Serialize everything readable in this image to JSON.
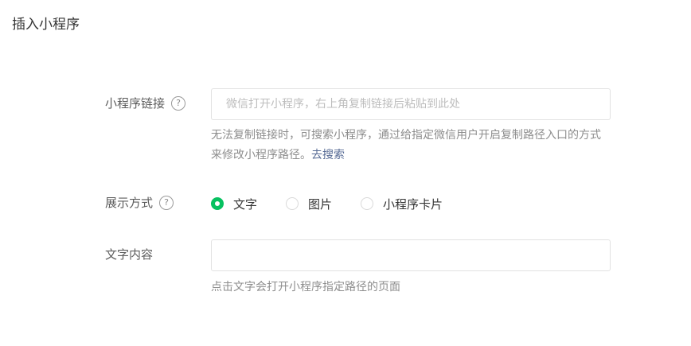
{
  "dialog": {
    "title": "插入小程序"
  },
  "link_field": {
    "label": "小程序链接",
    "help": "?",
    "placeholder": "微信打开小程序，右上角复制链接后粘贴到此处",
    "value": "",
    "tip": "无法复制链接时，可搜索小程序，通过给指定微信用户开启复制路径入口的方式来修改小程序路径。",
    "tip_link": "去搜索"
  },
  "display_mode": {
    "label": "展示方式",
    "help": "?",
    "options": [
      {
        "label": "文字",
        "selected": true
      },
      {
        "label": "图片",
        "selected": false
      },
      {
        "label": "小程序卡片",
        "selected": false
      }
    ]
  },
  "text_content": {
    "label": "文字内容",
    "value": "",
    "placeholder": "",
    "tip": "点击文字会打开小程序指定路径的页面"
  },
  "colors": {
    "accent": "#07c160",
    "link": "#576b95"
  }
}
